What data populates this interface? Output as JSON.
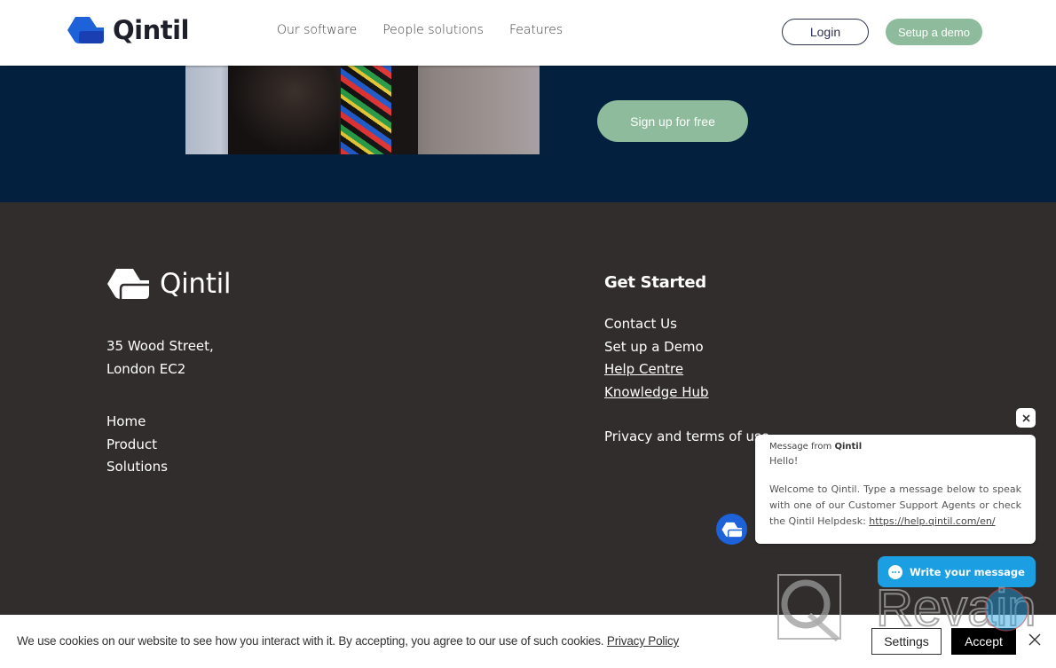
{
  "header": {
    "brand": "Qintil",
    "nav": [
      {
        "label": "Our software"
      },
      {
        "label": "People solutions"
      },
      {
        "label": "Features"
      }
    ],
    "login_label": "Login",
    "demo_label": "Setup a demo"
  },
  "hero": {
    "signup_label": "Sign up for free"
  },
  "footer": {
    "brand": "Qintil",
    "address": [
      "35 Wood Street,",
      "London EC2"
    ],
    "links": [
      {
        "label": "Home"
      },
      {
        "label": "Product"
      },
      {
        "label": "Solutions"
      }
    ],
    "get_started": {
      "title": "Get Started",
      "links": [
        {
          "label": "Contact Us"
        },
        {
          "label": "Set up a Demo"
        },
        {
          "label": "Help Centre"
        },
        {
          "label": "Knowledge Hub"
        }
      ],
      "privacy_label": "Privacy and terms of use"
    }
  },
  "chat": {
    "from_prefix": "Message from",
    "from_name": "Qintil",
    "greeting": "Hello!",
    "body": "Welcome to Qintil. Type a message below to speak with one of our Customer Support Agents or check the Qintil Helpdesk:",
    "link": "https://help.qintil.com/en/",
    "write_label": "Write your message"
  },
  "cookie": {
    "text": "We use cookies on our website to see how you interact with it. By accepting, you agree to our use of such cookies.",
    "policy_label": "Privacy Policy",
    "settings_label": "Settings",
    "accept_label": "Accept"
  },
  "watermark": {
    "text": "Revain"
  },
  "colors": {
    "accent_green": "#8dbb9c",
    "hero_navy": "#03213f",
    "footer_bg": "#302d2c",
    "brand_blue": "#1e62d9",
    "chat_blue": "#1b9fe2"
  }
}
